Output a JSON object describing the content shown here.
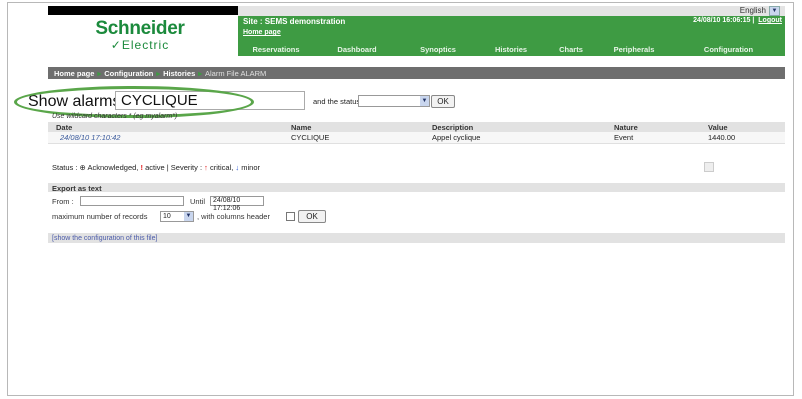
{
  "header": {
    "language": "English",
    "logo_line1": "Schneider",
    "logo_line2": "Electric",
    "site_title": "Site : SEMS demonstration",
    "home_link": "Home page",
    "datetime": "24/08/10 16:06:15",
    "logout": "Logout"
  },
  "nav": [
    "Reservations",
    "Dashboard",
    "Synoptics",
    "Histories",
    "Charts",
    "Peripherals",
    "Configuration"
  ],
  "breadcrumb": [
    "Home page",
    "Configuration",
    "Histories",
    "Alarm File ALARM"
  ],
  "filter": {
    "show_alarms_label": "Show alarms",
    "alarm_value": "CYCLIQUE",
    "status_label": "and the status",
    "status_value": "",
    "ok_label": "OK",
    "hint": "Use wildcard characters * (eg myalarm*)"
  },
  "table": {
    "columns": [
      "Date",
      "Name",
      "Description",
      "Nature",
      "Value"
    ],
    "rows": [
      [
        "24/08/10 17:10:42",
        "CYCLIQUE",
        "Appel cyclique",
        "Event",
        "1440.00"
      ]
    ]
  },
  "legend": {
    "status_label": "Status :",
    "acknowledged": "Acknowledged,",
    "active": "active",
    "severity_label": "| Severity :",
    "critical": "critical,",
    "minor": "minor"
  },
  "export": {
    "title": "Export as text",
    "from_label": "From :",
    "from_value": "",
    "until_label": "Until",
    "until_value": "24/08/10 17:12:06",
    "max_label": "maximum number of records",
    "max_value": "10",
    "columns_header_label": ", with columns header",
    "ok_label": "OK"
  },
  "config_link": "[show the configuration of this file]",
  "colors": {
    "brand_green": "#3e9b43",
    "crumb_bar": "#6e6e6e",
    "highlight_ellipse": "#5aa64a"
  }
}
